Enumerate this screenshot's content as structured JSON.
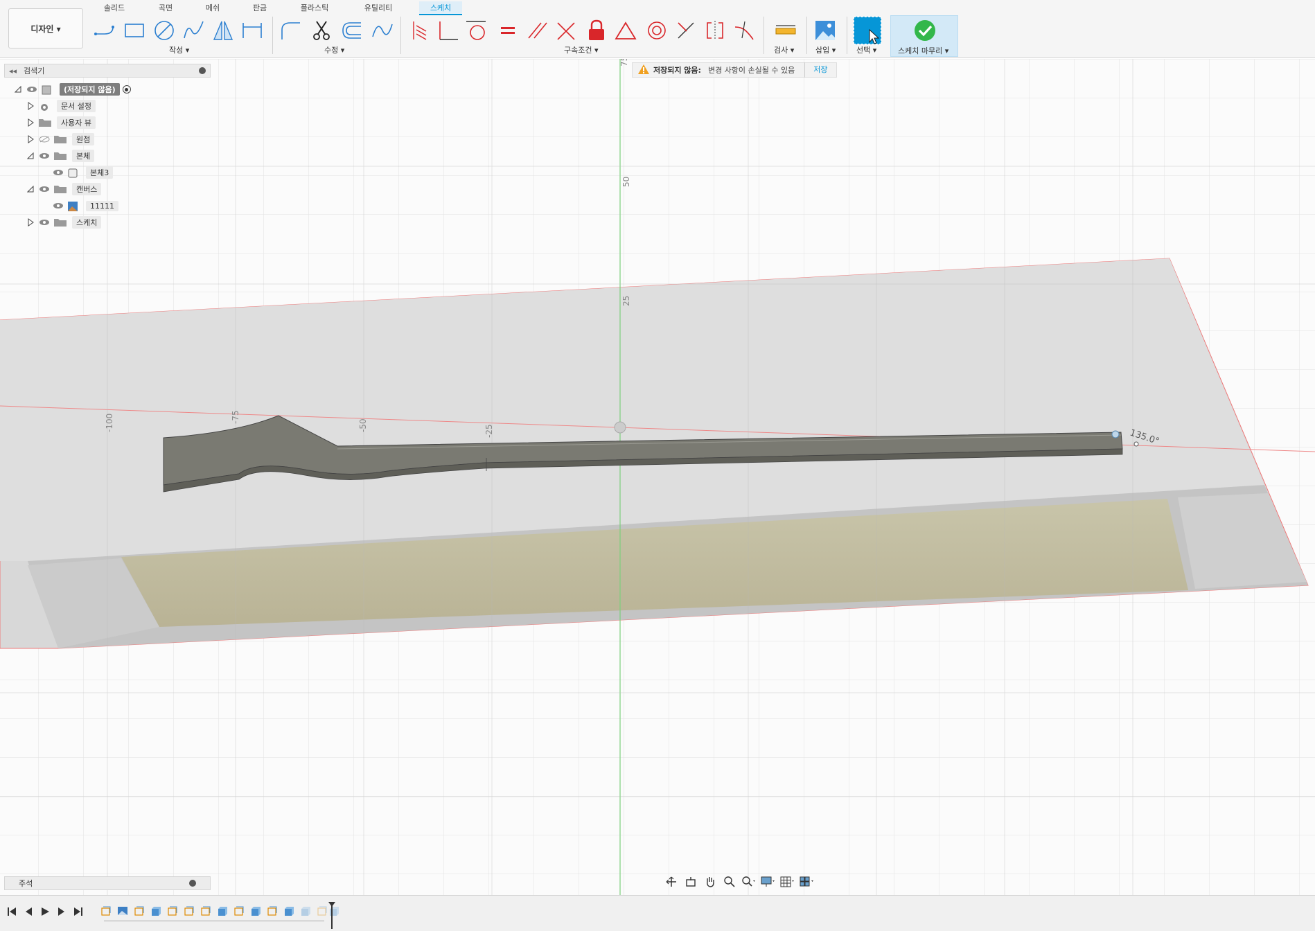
{
  "workspace": {
    "label": "디자인 ▾"
  },
  "tabs": [
    {
      "label": "솔리드",
      "active": false
    },
    {
      "label": "곡면",
      "active": false
    },
    {
      "label": "메쉬",
      "active": false
    },
    {
      "label": "판금",
      "active": false
    },
    {
      "label": "플라스틱",
      "active": false
    },
    {
      "label": "유틸리티",
      "active": false
    },
    {
      "label": "스케치",
      "active": true
    }
  ],
  "toolbar_groups": {
    "create": "작성 ▾",
    "modify": "수정 ▾",
    "constraints": "구속조건 ▾",
    "inspect": "검사 ▾",
    "insert": "삽입 ▾",
    "select": "선택 ▾",
    "finish": "스케치 마무리 ▾"
  },
  "browser": {
    "title": "검색기",
    "root": "(저장되지 않음)",
    "items": [
      {
        "label": "문서 설정",
        "icon": "gear-icon"
      },
      {
        "label": "사용자 뷰",
        "icon": "folder-icon"
      },
      {
        "label": "원점",
        "icon": "folder-icon"
      },
      {
        "label": "본체",
        "icon": "folder-icon"
      },
      {
        "label": "본체3",
        "icon": "body-icon"
      },
      {
        "label": "캔버스",
        "icon": "folder-icon"
      },
      {
        "label": "11111",
        "icon": "image-icon"
      },
      {
        "label": "스케치",
        "icon": "folder-icon"
      }
    ]
  },
  "warning": {
    "title": "저장되지 않음:",
    "message": "변경 사항이 손실될 수 있음",
    "save": "저장"
  },
  "comments": {
    "label": "주석"
  },
  "viewport": {
    "ruler_v": [
      "75",
      "50",
      "25"
    ],
    "ruler_h": [
      "-100",
      "-75",
      "-50",
      "-25"
    ],
    "angle_dim": "135.0°"
  },
  "colors": {
    "accent": "#0696d7",
    "constraint": "#d9262a",
    "finish_green": "#33b74a"
  }
}
